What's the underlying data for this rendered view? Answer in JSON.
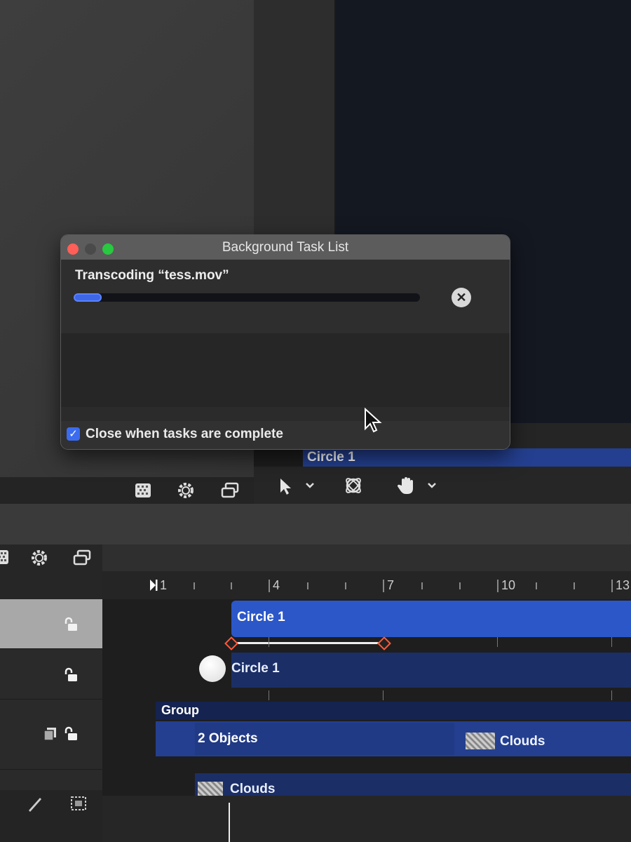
{
  "dialog": {
    "title": "Background Task List",
    "task_label": "Transcoding “tess.mov”",
    "progress": 0.08,
    "close_when_complete_label": "Close when tasks are complete",
    "close_when_complete_checked": true
  },
  "viewer": {
    "selected_layer": "Circle 1"
  },
  "ruler": {
    "ticks": [
      "1",
      "4",
      "7",
      "10",
      "13"
    ]
  },
  "timeline": {
    "circle_bar": "Circle 1",
    "circle_object": "Circle 1",
    "group_label": "Group",
    "group_objects": "2 Objects",
    "clouds_in_group": "Clouds",
    "clouds_layer": "Clouds"
  },
  "colors": {
    "accent": "#3d67e6",
    "selected_bar": "#2b57c8",
    "track_bar": "#1b2e66"
  }
}
